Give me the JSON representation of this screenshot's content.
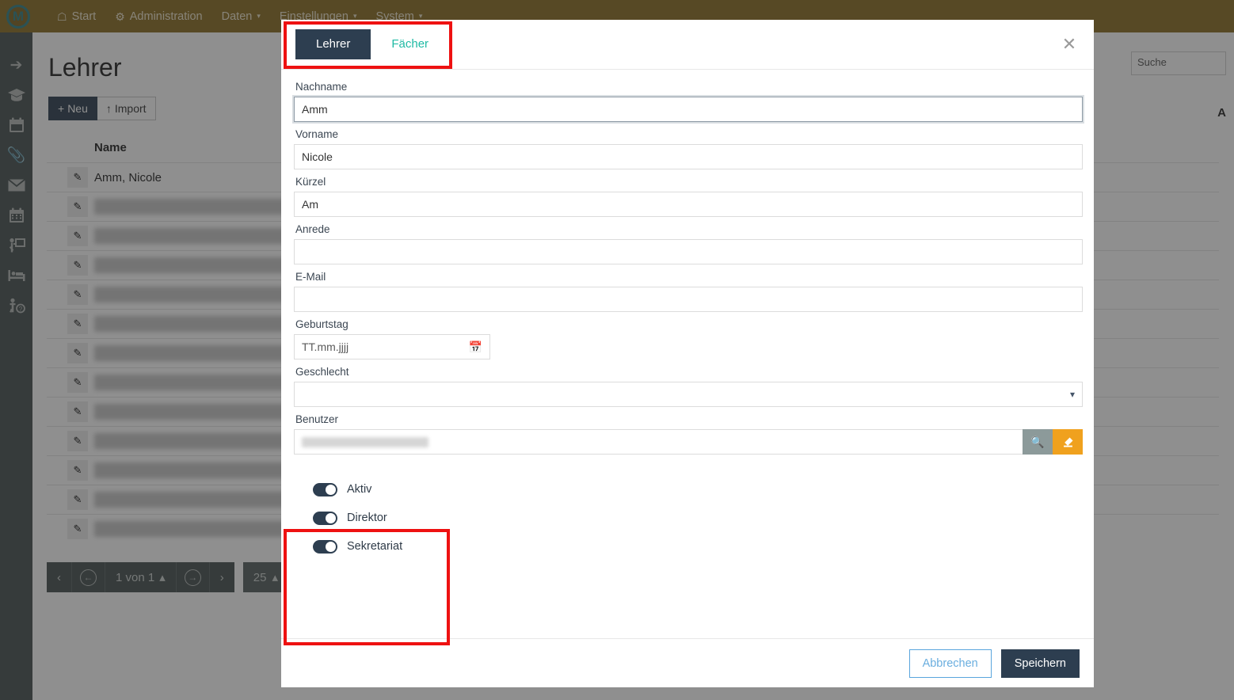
{
  "topbar": {
    "logo": "m-logo-icon",
    "nav": [
      {
        "label": "Start",
        "icon": "home-icon",
        "caret": ""
      },
      {
        "label": "Administration",
        "icon": "gear-icon",
        "caret": ""
      },
      {
        "label": "Daten",
        "icon": "",
        "caret": "▾"
      },
      {
        "label": "Einstellungen",
        "icon": "",
        "caret": "▾"
      },
      {
        "label": "System",
        "icon": "",
        "caret": "▾"
      }
    ]
  },
  "sidebar": {
    "items": [
      {
        "name": "logout-icon"
      },
      {
        "name": "graduation-cap-icon"
      },
      {
        "name": "calendar-icon"
      },
      {
        "name": "paperclip-icon"
      },
      {
        "name": "envelope-icon"
      },
      {
        "name": "calendar-grid-icon"
      },
      {
        "name": "teacher-board-icon"
      },
      {
        "name": "bed-icon"
      },
      {
        "name": "person-help-icon"
      }
    ]
  },
  "page": {
    "title": "Lehrer",
    "buttons": {
      "new": "Neu",
      "new_icon": "plus-icon",
      "import": "Import",
      "import_icon": "upload-arrow-icon"
    },
    "search_placeholder": "Suche",
    "table": {
      "headers": [
        "Name",
        "A"
      ],
      "rows": [
        {
          "name": "Amm, Nicole",
          "redacted": false
        },
        {
          "name": "",
          "redacted": true
        },
        {
          "name": "",
          "redacted": true
        },
        {
          "name": "",
          "redacted": true
        },
        {
          "name": "",
          "redacted": true
        },
        {
          "name": "",
          "redacted": true
        },
        {
          "name": "",
          "redacted": true
        },
        {
          "name": "",
          "redacted": true
        },
        {
          "name": "",
          "redacted": true
        },
        {
          "name": "",
          "redacted": true
        },
        {
          "name": "",
          "redacted": true
        },
        {
          "name": "",
          "redacted": true
        },
        {
          "name": "",
          "redacted": true
        }
      ]
    },
    "pager": {
      "first": "‹",
      "prev": "←",
      "info": "1 von 1",
      "info_caret": "▴",
      "next": "→",
      "last": "›",
      "page_size": "25",
      "page_size_caret": "▴"
    }
  },
  "modal": {
    "tabs": [
      {
        "label": "Lehrer",
        "active": true
      },
      {
        "label": "Fächer",
        "active": false
      }
    ],
    "close_icon": "✕",
    "fields": [
      {
        "label": "Nachname",
        "value": "Amm",
        "placeholder": "",
        "focused": true
      },
      {
        "label": "Vorname",
        "value": "Nicole",
        "placeholder": "",
        "focused": false
      },
      {
        "label": "Kürzel",
        "value": "Am",
        "placeholder": "",
        "focused": false
      },
      {
        "label": "Anrede",
        "value": "",
        "placeholder": "",
        "focused": false
      },
      {
        "label": "E-Mail",
        "value": "",
        "placeholder": "",
        "focused": false
      }
    ],
    "birthday": {
      "label": "Geburtstag",
      "value": "",
      "placeholder": "TT.mm.jjjj",
      "icon": "calendar-icon"
    },
    "gender": {
      "label": "Geschlecht",
      "value": "",
      "caret": "⌄"
    },
    "user": {
      "label": "Benutzer",
      "value": "",
      "redacted": true,
      "search_icon": "search-icon",
      "erase_icon": "eraser-icon"
    },
    "toggles": [
      {
        "label": "Aktiv",
        "on": true
      },
      {
        "label": "Direktor",
        "on": true
      },
      {
        "label": "Sekretariat",
        "on": true
      }
    ],
    "footer": {
      "cancel": "Abbrechen",
      "save": "Speichern"
    }
  },
  "annotations": {
    "highlights": [
      {
        "name": "highlight-tabs",
        "color": "#ee1111"
      },
      {
        "name": "highlight-toggles",
        "color": "#ee1111"
      }
    ]
  }
}
